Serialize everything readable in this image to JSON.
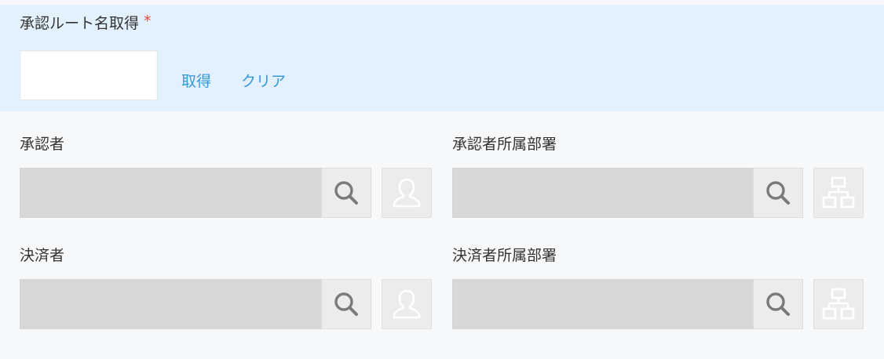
{
  "route": {
    "label": "承認ルート名取得",
    "required_mark": "*",
    "input_value": "",
    "get_label": "取得",
    "clear_label": "クリア"
  },
  "approver": {
    "label": "承認者",
    "value": "",
    "search_icon": "search-icon",
    "picker_icon": "user-icon"
  },
  "approver_dept": {
    "label": "承認者所属部署",
    "value": "",
    "search_icon": "search-icon",
    "picker_icon": "org-chart-icon"
  },
  "settler": {
    "label": "決済者",
    "value": "",
    "search_icon": "search-icon",
    "picker_icon": "user-icon"
  },
  "settler_dept": {
    "label": "決済者所属部署",
    "value": "",
    "search_icon": "search-icon",
    "picker_icon": "org-chart-icon"
  },
  "colors": {
    "panel_bg": "#e2f1fd",
    "page_bg": "#f6f8fa",
    "link": "#3498db",
    "required": "#e74c3c",
    "field_disabled": "#d8d8d8",
    "button_bg": "#ececec",
    "icon_dark": "#7a7a7a",
    "icon_light": "#ffffff"
  }
}
